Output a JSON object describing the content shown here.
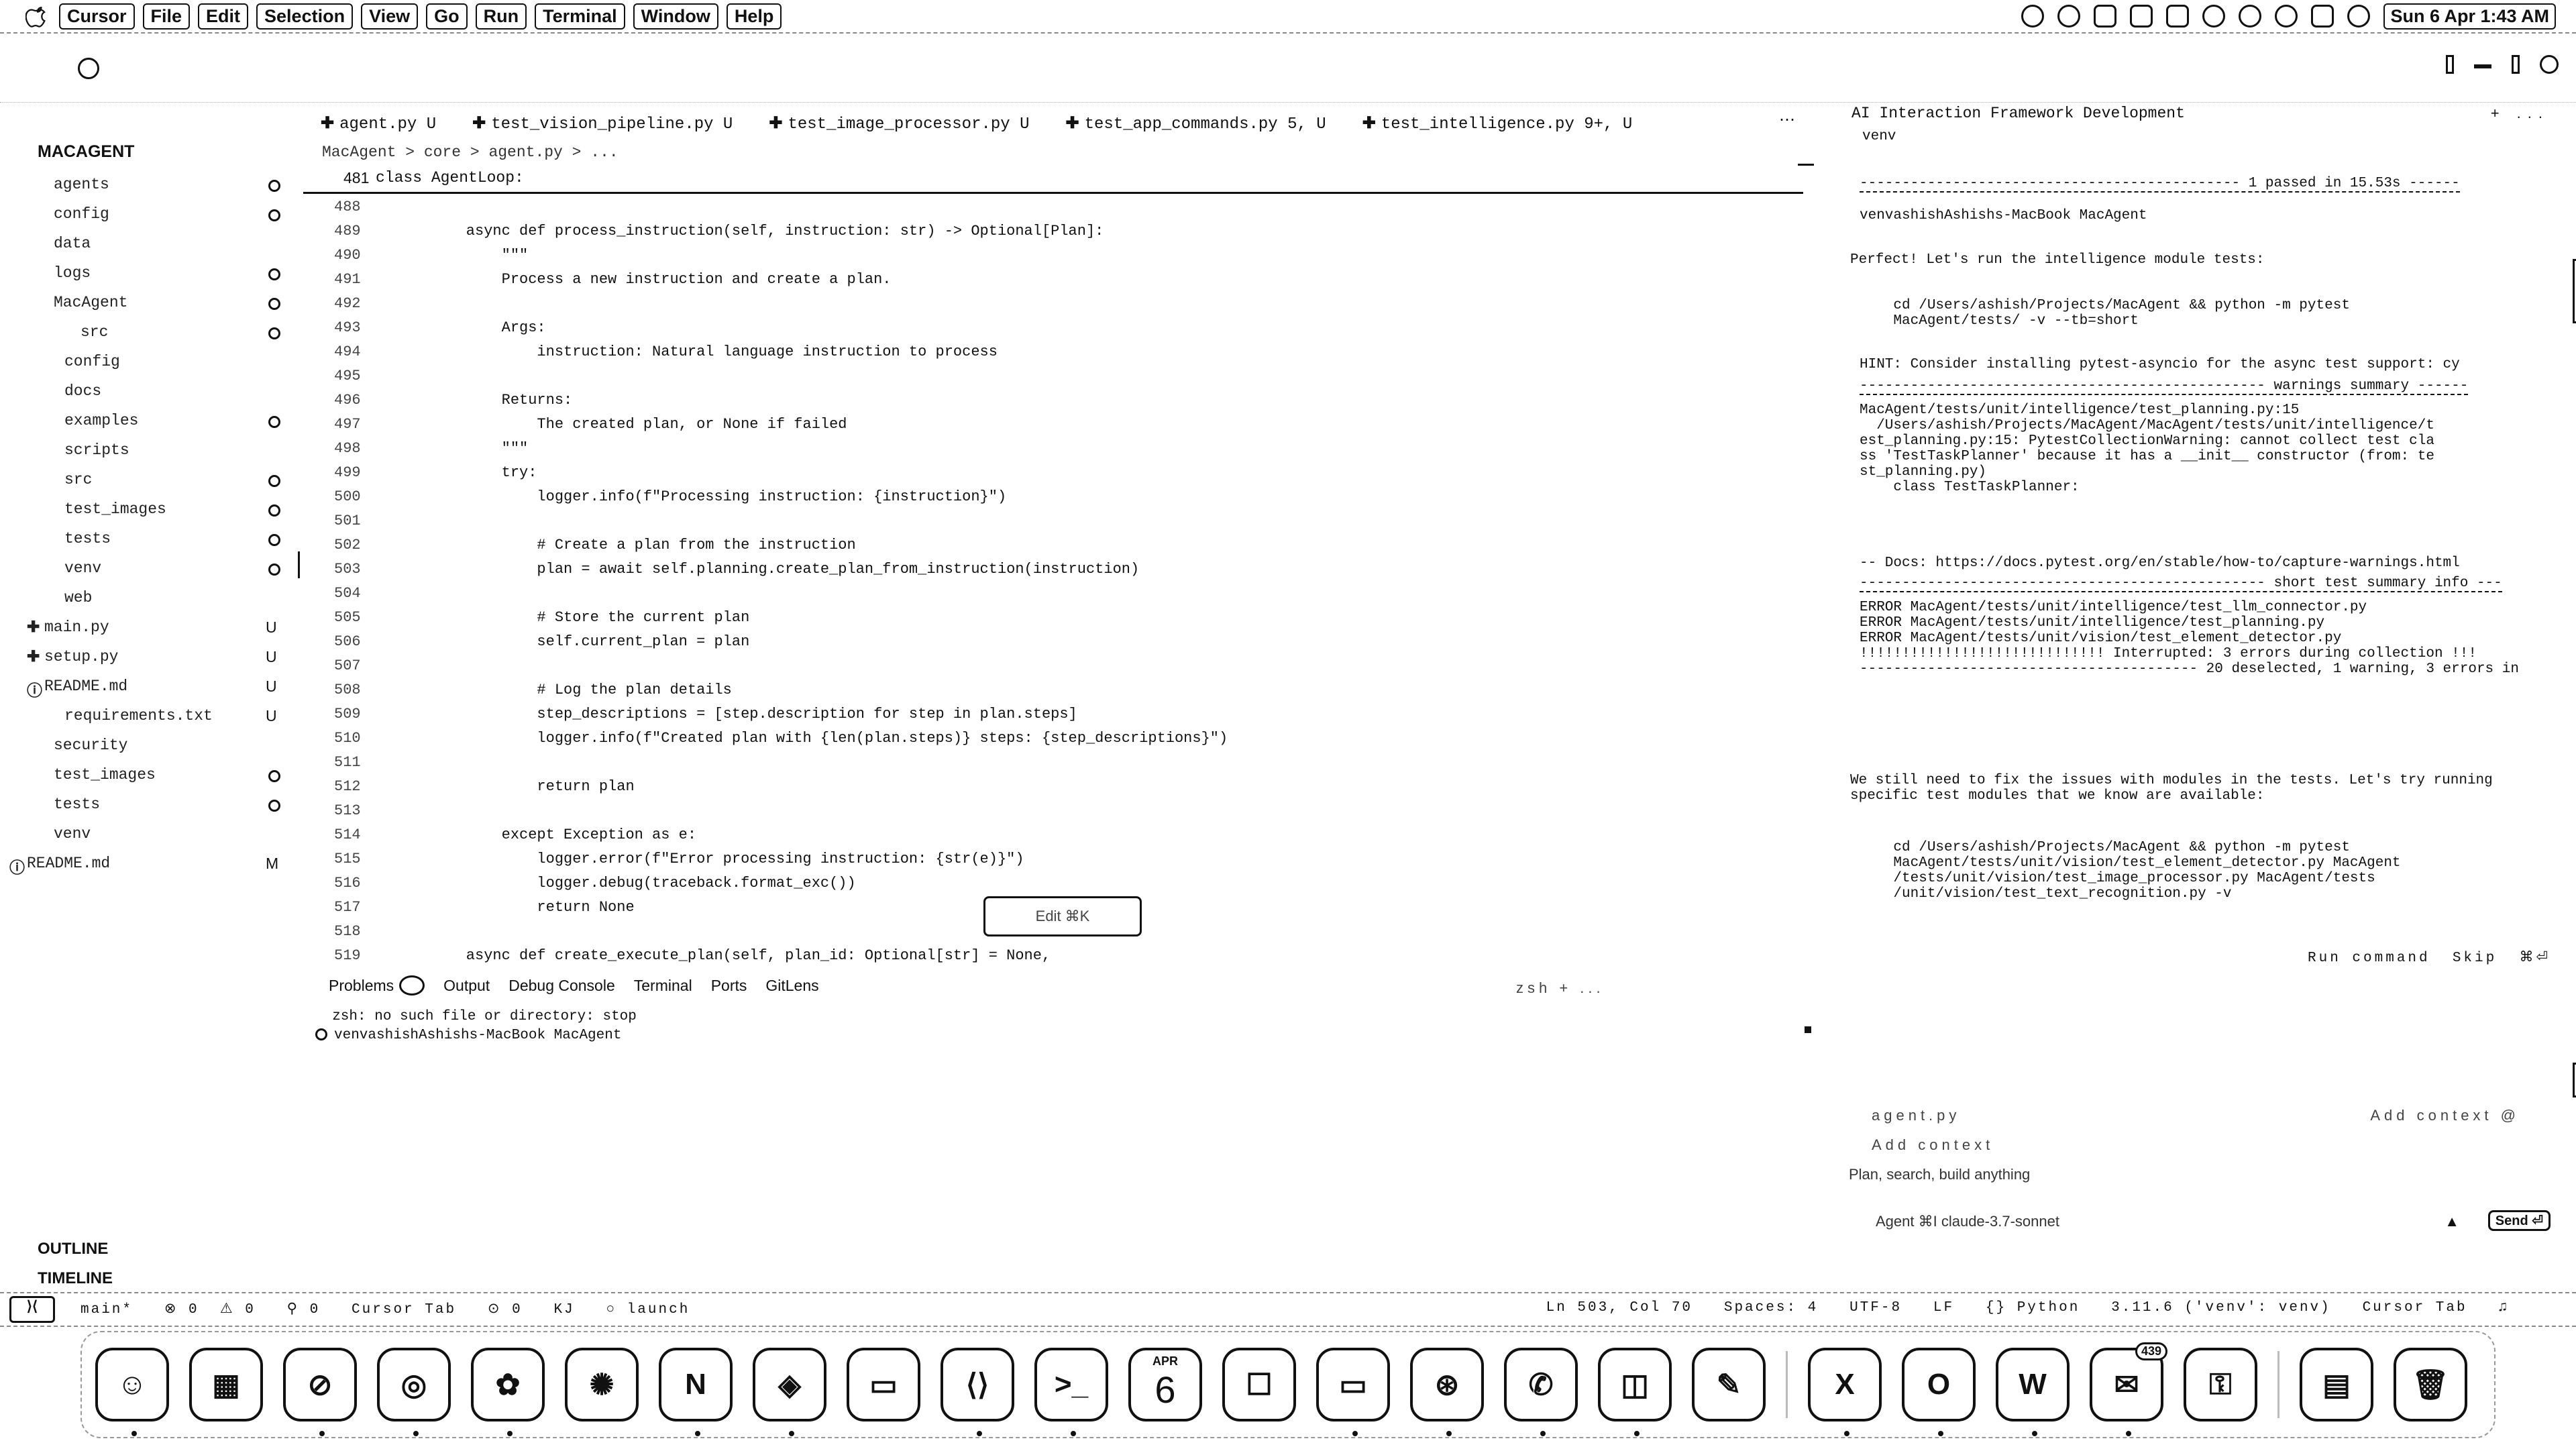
{
  "menubar": {
    "app_name": "Cursor",
    "items": [
      "File",
      "Edit",
      "Selection",
      "View",
      "Go",
      "Run",
      "Terminal",
      "Window",
      "Help"
    ],
    "clock": "Sun 6 Apr  1:43 AM"
  },
  "sidebar": {
    "project_title": "MACAGENT",
    "tree": [
      {
        "name": "agents",
        "indent": 80,
        "status": "dot"
      },
      {
        "name": "config",
        "indent": 80,
        "status": "dot"
      },
      {
        "name": "data",
        "indent": 80,
        "status": ""
      },
      {
        "name": "logs",
        "indent": 80,
        "status": "dot"
      },
      {
        "name": "MacAgent",
        "indent": 80,
        "status": "dot"
      },
      {
        "name": "src",
        "indent": 120,
        "status": "dot"
      },
      {
        "name": "config",
        "indent": 96,
        "status": ""
      },
      {
        "name": "docs",
        "indent": 96,
        "status": ""
      },
      {
        "name": "examples",
        "indent": 96,
        "status": "dot"
      },
      {
        "name": "scripts",
        "indent": 96,
        "status": ""
      },
      {
        "name": "src",
        "indent": 96,
        "status": "dot"
      },
      {
        "name": "test_images",
        "indent": 96,
        "status": "dot"
      },
      {
        "name": "tests",
        "indent": 96,
        "status": "dot"
      },
      {
        "name": "venv",
        "indent": 96,
        "status": "dot"
      },
      {
        "name": "web",
        "indent": 96,
        "status": ""
      },
      {
        "name": "main.py",
        "indent": 66,
        "status": "U",
        "icon": "py"
      },
      {
        "name": "setup.py",
        "indent": 66,
        "status": "U",
        "icon": "py"
      },
      {
        "name": "README.md",
        "indent": 66,
        "status": "U",
        "icon": "md"
      },
      {
        "name": "requirements.txt",
        "indent": 96,
        "status": "U"
      },
      {
        "name": "security",
        "indent": 80,
        "status": ""
      },
      {
        "name": "test_images",
        "indent": 80,
        "status": "dot"
      },
      {
        "name": "tests",
        "indent": 80,
        "status": "dot"
      },
      {
        "name": "venv",
        "indent": 80,
        "status": ""
      },
      {
        "name": "README.md",
        "indent": 40,
        "status": "M",
        "icon": "md"
      }
    ],
    "outline_label": "OUTLINE",
    "timeline_label": "TIMELINE"
  },
  "editor": {
    "tabs": [
      {
        "label": "agent.py",
        "badge": "U"
      },
      {
        "label": "test_vision_pipeline.py",
        "badge": "U"
      },
      {
        "label": "test_image_processor.py",
        "badge": "U"
      },
      {
        "label": "test_app_commands.py",
        "badge": "5, U"
      },
      {
        "label": "test_intelligence.py",
        "badge": "9+, U"
      }
    ],
    "breadcrumb": "MacAgent  >  core  >  agent.py  >  ...",
    "sticky_line_number": "481",
    "sticky_code": "class AgentLoop:",
    "lines": [
      {
        "n": "488",
        "t": ""
      },
      {
        "n": "489",
        "t": "    async def process_instruction(self, instruction: str) -> Optional[Plan]:"
      },
      {
        "n": "490",
        "t": "        \"\"\""
      },
      {
        "n": "491",
        "t": "        Process a new instruction and create a plan."
      },
      {
        "n": "492",
        "t": ""
      },
      {
        "n": "493",
        "t": "        Args:"
      },
      {
        "n": "494",
        "t": "            instruction: Natural language instruction to process"
      },
      {
        "n": "495",
        "t": ""
      },
      {
        "n": "496",
        "t": "        Returns:"
      },
      {
        "n": "497",
        "t": "            The created plan, or None if failed"
      },
      {
        "n": "498",
        "t": "        \"\"\""
      },
      {
        "n": "499",
        "t": "        try:"
      },
      {
        "n": "500",
        "t": "            logger.info(f\"Processing instruction: {instruction}\")"
      },
      {
        "n": "501",
        "t": ""
      },
      {
        "n": "502",
        "t": "            # Create a plan from the instruction"
      },
      {
        "n": "503",
        "t": "            plan = await self.planning.create_plan_from_instruction(instruction)"
      },
      {
        "n": "504",
        "t": ""
      },
      {
        "n": "505",
        "t": "            # Store the current plan"
      },
      {
        "n": "506",
        "t": "            self.current_plan = plan"
      },
      {
        "n": "507",
        "t": ""
      },
      {
        "n": "508",
        "t": "            # Log the plan details"
      },
      {
        "n": "509",
        "t": "            step_descriptions = [step.description for step in plan.steps]"
      },
      {
        "n": "510",
        "t": "            logger.info(f\"Created plan with {len(plan.steps)} steps: {step_descriptions}\")"
      },
      {
        "n": "511",
        "t": ""
      },
      {
        "n": "512",
        "t": "            return plan"
      },
      {
        "n": "513",
        "t": ""
      },
      {
        "n": "514",
        "t": "        except Exception as e:"
      },
      {
        "n": "515",
        "t": "            logger.error(f\"Error processing instruction: {str(e)}\")"
      },
      {
        "n": "516",
        "t": "            logger.debug(traceback.format_exc())"
      },
      {
        "n": "517",
        "t": "            return None"
      },
      {
        "n": "518",
        "t": ""
      },
      {
        "n": "519",
        "t": "    async def create_execute_plan(self, plan_id: Optional[str] = None,"
      }
    ],
    "edit_widget_label": "Edit  ⌘K"
  },
  "panel": {
    "tabs": [
      "Problems",
      "Output",
      "Debug Console",
      "Terminal",
      "Ports",
      "GitLens"
    ],
    "right_controls": "zsh  +  ...",
    "terminal_lines": [
      "  zsh: no such file or directory: stop",
      "venvashishAshishs-MacBook MacAgent"
    ]
  },
  "chat": {
    "title": "AI Interaction Framework Development",
    "title_actions": "+  ...",
    "header_sub": "venv",
    "blocks": [
      {
        "kind": "rule",
        "text": "--------------------------------------------- 1 passed in 15.53s ------"
      },
      {
        "kind": "term",
        "text": "venvashishAshishs-MacBook MacAgent"
      },
      {
        "kind": "para",
        "text": "Perfect! Let's run the intelligence module tests:"
      },
      {
        "kind": "term",
        "text": "    cd /Users/ashish/Projects/MacAgent && python -m pytest\n    MacAgent/tests/ -v --tb=short"
      },
      {
        "kind": "term",
        "text": "HINT: Consider installing pytest-asyncio for the async test support: cy"
      },
      {
        "kind": "rule",
        "text": "------------------------------------------------ warnings summary ------"
      },
      {
        "kind": "term",
        "text": "MacAgent/tests/unit/intelligence/test_planning.py:15\n  /Users/ashish/Projects/MacAgent/MacAgent/tests/unit/intelligence/t\nest_planning.py:15: PytestCollectionWarning: cannot collect test cla\nss 'TestTaskPlanner' because it has a __init__ constructor (from: te\nst_planning.py)\n    class TestTaskPlanner:"
      },
      {
        "kind": "term",
        "text": "-- Docs: https://docs.pytest.org/en/stable/how-to/capture-warnings.html"
      },
      {
        "kind": "rule",
        "text": "------------------------------------------------ short test summary info ---"
      },
      {
        "kind": "term",
        "text": "ERROR MacAgent/tests/unit/intelligence/test_llm_connector.py\nERROR MacAgent/tests/unit/intelligence/test_planning.py\nERROR MacAgent/tests/unit/vision/test_element_detector.py\n!!!!!!!!!!!!!!!!!!!!!!!!!!!!! Interrupted: 3 errors during collection !!!\n---------------------------------------- 20 deselected, 1 warning, 3 errors in"
      },
      {
        "kind": "para",
        "text": "We still need to fix the issues with modules in the tests. Let's try running\nspecific test modules that we know are available:"
      },
      {
        "kind": "term",
        "text": "    cd /Users/ashish/Projects/MacAgent && python -m pytest\n    MacAgent/tests/unit/vision/test_element_detector.py MacAgent\n    /tests/unit/vision/test_image_processor.py MacAgent/tests\n    /unit/vision/test_text_recognition.py -v"
      }
    ],
    "block_footer": "Run command  Skip  ⌘⏎",
    "input_top_left": "agent.py",
    "input_top_right": "Add context  @",
    "input_hint": "Add context",
    "placeholder": "Plan, search, build anything",
    "agent_selector": "Agent  ⌘I   claude-3.7-sonnet",
    "send_label": "Send ⏎"
  },
  "statusbar": {
    "left": "main*   ⊗ 0  ⚠ 0   ⚲ 0   Cursor Tab   ⊙ 0   KJ   ○ launch",
    "right": "Ln 503, Col 70   Spaces: 4   UTF-8   LF   {} Python   3.11.6 ('venv': venv)   Cursor Tab   ♫"
  },
  "dock": {
    "apps": [
      {
        "name": "finder-icon",
        "glyph": "☺"
      },
      {
        "name": "launchpad-icon",
        "glyph": "▦"
      },
      {
        "name": "safari-icon",
        "glyph": "⊘"
      },
      {
        "name": "chrome-icon",
        "glyph": "◎"
      },
      {
        "name": "chatgpt-icon",
        "glyph": "✿"
      },
      {
        "name": "claude-icon",
        "glyph": "✺"
      },
      {
        "name": "notion-icon",
        "glyph": "N"
      },
      {
        "name": "cursor-icon",
        "glyph": "◈"
      },
      {
        "name": "preview-icon",
        "glyph": "▭"
      },
      {
        "name": "vscode-icon",
        "glyph": "⟨⟩"
      },
      {
        "name": "terminal-icon",
        "glyph": ">_"
      },
      {
        "name": "calendar-icon",
        "glyph": "6",
        "month": "APR"
      },
      {
        "name": "notes-icon",
        "glyph": "☐"
      },
      {
        "name": "window-icon",
        "glyph": "▭"
      },
      {
        "name": "steam-icon",
        "glyph": "⊛"
      },
      {
        "name": "whatsapp-icon",
        "glyph": "✆"
      },
      {
        "name": "trello-icon",
        "glyph": "◫"
      },
      {
        "name": "script-icon",
        "glyph": "✎"
      },
      {
        "name": "excel-icon",
        "glyph": "X"
      },
      {
        "name": "outlook-icon",
        "glyph": "O"
      },
      {
        "name": "word-icon",
        "glyph": "W"
      },
      {
        "name": "messages-icon",
        "glyph": "✉",
        "badge": "439"
      },
      {
        "name": "passwords-icon",
        "glyph": "⚿"
      },
      {
        "name": "downloads-icon",
        "glyph": "▤"
      },
      {
        "name": "trash-icon",
        "glyph": "🗑"
      }
    ]
  }
}
